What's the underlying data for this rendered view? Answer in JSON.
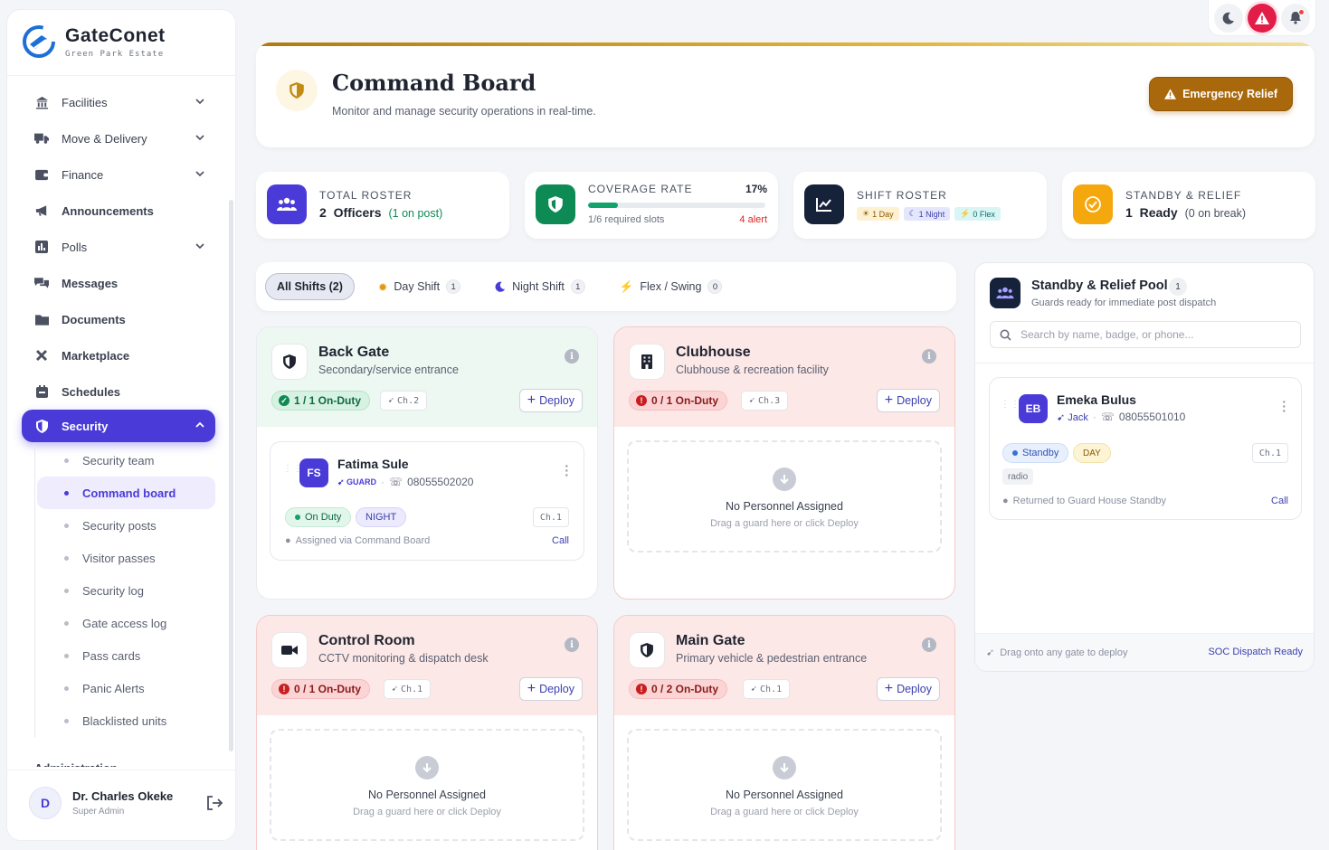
{
  "brand": {
    "title": "GateConet",
    "subtitle": "Green Park Estate"
  },
  "sidebar": {
    "items": [
      {
        "label": "Facilities",
        "icon": "bank-icon",
        "chevron": true
      },
      {
        "label": "Move & Delivery",
        "icon": "truck-icon",
        "chevron": true
      },
      {
        "label": "Finance",
        "icon": "wallet-icon",
        "chevron": true
      },
      {
        "label": "Announcements",
        "icon": "megaphone-icon",
        "chevron": false
      },
      {
        "label": "Polls",
        "icon": "poll-icon",
        "chevron": true
      },
      {
        "label": "Messages",
        "icon": "messages-icon",
        "chevron": false
      },
      {
        "label": "Documents",
        "icon": "folder-icon",
        "chevron": false
      },
      {
        "label": "Marketplace",
        "icon": "tools-icon",
        "chevron": false
      },
      {
        "label": "Schedules",
        "icon": "calendar-icon",
        "chevron": false
      },
      {
        "label": "Security",
        "icon": "shield-icon",
        "chevron": true
      }
    ],
    "sub_items": [
      "Security team",
      "Command board",
      "Security posts",
      "Visitor passes",
      "Security log",
      "Gate access log",
      "Pass cards",
      "Panic Alerts",
      "Blacklisted units"
    ],
    "active_sub": "Command board",
    "partial_item": "Administration",
    "user": {
      "initial": "D",
      "name": "Dr. Charles Okeke",
      "role": "Super Admin"
    }
  },
  "header": {
    "title": "Command Board",
    "subtitle": "Monitor and manage security operations in real-time.",
    "emergency_label": "Emergency Relief"
  },
  "stats": {
    "roster": {
      "label": "TOTAL ROSTER",
      "value": "2",
      "unit": "Officers",
      "extra": "(1 on post)"
    },
    "coverage": {
      "label": "COVERAGE RATE",
      "percent_text": "17%",
      "progress": 0.17,
      "slots": "1/6 required slots",
      "alert": "4 alert"
    },
    "shift": {
      "label": "SHIFT ROSTER",
      "day": "1 Day",
      "night": "1 Night",
      "flex": "0 Flex"
    },
    "standby": {
      "label": "STANDBY & RELIEF",
      "value": "1",
      "unit": "Ready",
      "extra": "(0 on break)"
    }
  },
  "filters": [
    {
      "label": "All Shifts (2)",
      "count": ""
    },
    {
      "label": "Day Shift",
      "count": "1"
    },
    {
      "label": "Night Shift",
      "count": "1"
    },
    {
      "label": "Flex / Swing",
      "count": "0"
    }
  ],
  "posts": [
    {
      "name": "Back Gate",
      "desc": "Secondary/service entrance",
      "duty": "1 / 1 On-Duty",
      "channel": "Ch.2",
      "deploy": "Deploy"
    },
    {
      "name": "Clubhouse",
      "desc": "Clubhouse & recreation facility",
      "duty": "0 / 1 On-Duty",
      "channel": "Ch.3",
      "deploy": "Deploy"
    },
    {
      "name": "Control Room",
      "desc": "CCTV monitoring & dispatch desk",
      "duty": "0 / 1 On-Duty",
      "channel": "Ch.1",
      "deploy": "Deploy"
    },
    {
      "name": "Main Gate",
      "desc": "Primary vehicle & pedestrian entrance",
      "duty": "0 / 2 On-Duty",
      "channel": "Ch.1",
      "deploy": "Deploy"
    }
  ],
  "empty": {
    "title": "No Personnel Assigned",
    "hint": "Drag a guard here or click Deploy"
  },
  "guard": {
    "initials": "FS",
    "name": "Fatima Sule",
    "role": "GUARD",
    "phone": "08055502020",
    "status": "On Duty",
    "shift": "NIGHT",
    "channel": "Ch.1",
    "note": "Assigned via Command Board",
    "call": "Call"
  },
  "pool": {
    "title": "Standby & Relief Pool",
    "count": "1",
    "subtitle": "Guards ready for immediate post dispatch",
    "search_placeholder": "Search by name, badge, or phone...",
    "guard": {
      "initials": "EB",
      "name": "Emeka Bulus",
      "callsign": "Jack",
      "phone": "08055501010",
      "status": "Standby",
      "shift": "DAY",
      "channel": "Ch.1",
      "tag": "radio",
      "note": "Returned to Guard House Standby",
      "call": "Call"
    },
    "footer_left": "Drag onto any gate to deploy",
    "footer_right": "SOC Dispatch Ready"
  },
  "colors": {
    "accent": "#4a3bd8",
    "gold": "#a8680b",
    "success": "#0e8a55",
    "danger": "#c81e1e"
  }
}
